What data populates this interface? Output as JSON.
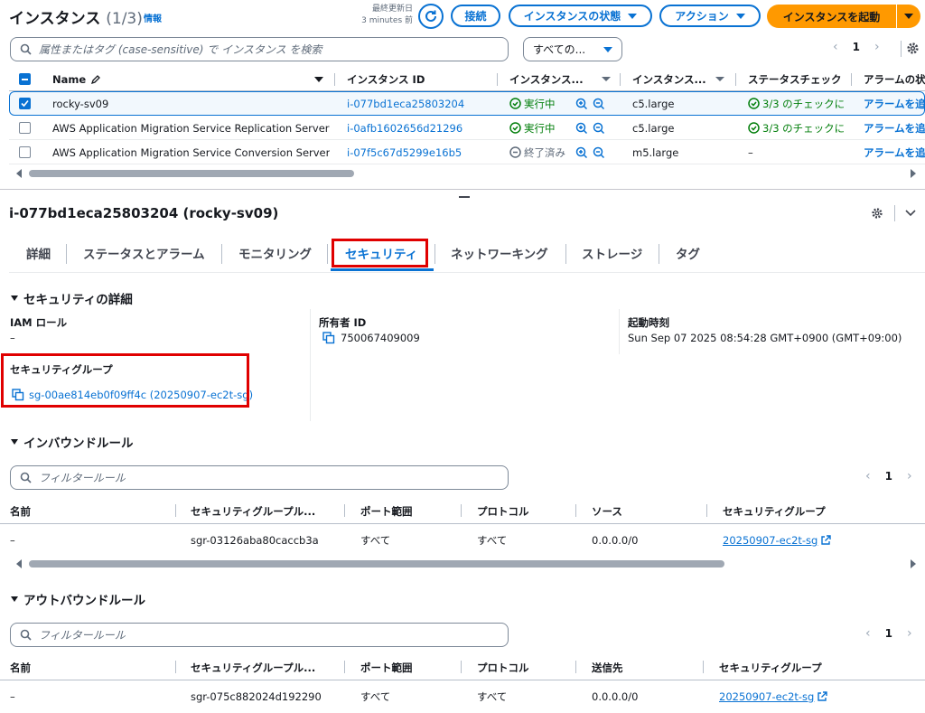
{
  "header": {
    "title": "インスタンス",
    "count": "(1/3)",
    "info": "情報",
    "last_updated_label": "最終更新日",
    "last_updated_value": "3 minutes 前",
    "connect": "接続",
    "instance_state": "インスタンスの状態",
    "actions": "アクション",
    "launch": "インスタンスを起動"
  },
  "search": {
    "placeholder": "属性またはタグ (case-sensitive) で インスタンス を検索",
    "filter": "すべての..."
  },
  "pager": {
    "page": "1"
  },
  "instances": {
    "columns": [
      "Name",
      "インスタンス ID",
      "インスタンス...",
      "インスタンス...",
      "ステータスチェック",
      "アラームの状"
    ],
    "rows": [
      {
        "name": "rocky-sv09",
        "id": "i-077bd1eca25803204",
        "state": "実行中",
        "type": "c5.large",
        "check": "3/3 のチェックに",
        "alarm": "アラームを追"
      },
      {
        "name": "AWS Application Migration Service Replication Server",
        "id": "i-0afb1602656d21296",
        "state": "実行中",
        "type": "c5.large",
        "check": "3/3 のチェックに",
        "alarm": "アラームを追"
      },
      {
        "name": "AWS Application Migration Service Conversion Server",
        "id": "i-07f5c67d5299e16b5",
        "state": "終了済み",
        "type": "m5.large",
        "check": "–",
        "alarm": "アラームを追"
      }
    ]
  },
  "detail": {
    "title": "i-077bd1eca25803204 (rocky-sv09)",
    "tabs": [
      "詳細",
      "ステータスとアラーム",
      "モニタリング",
      "セキュリティ",
      "ネットワーキング",
      "ストレージ",
      "タグ"
    ],
    "security_details": "セキュリティの詳細",
    "iam_label": "IAM ロール",
    "iam_value": "–",
    "owner_label": "所有者 ID",
    "owner_value": "750067409009",
    "launch_label": "起動時刻",
    "launch_value": "Sun Sep 07 2025 08:54:28 GMT+0900 (GMT+09:00)",
    "sg_label": "セキュリティグループ",
    "sg_value": "sg-00ae814eb0f09ff4c (20250907-ec2t-sg)"
  },
  "inbound": {
    "title": "インバウンドルール",
    "placeholder": "フィルタールール",
    "page": "1",
    "columns": [
      "名前",
      "セキュリティグループル...",
      "ポート範囲",
      "プロトコル",
      "ソース",
      "セキュリティグループ"
    ],
    "row": {
      "name": "–",
      "rule_id": "sgr-03126aba80caccb3a",
      "port": "すべて",
      "protocol": "すべて",
      "source": "0.0.0.0/0",
      "sg": "20250907-ec2t-sg"
    }
  },
  "outbound": {
    "title": "アウトバウンドルール",
    "placeholder": "フィルタールール",
    "page": "1",
    "columns": [
      "名前",
      "セキュリティグループル...",
      "ポート範囲",
      "プロトコル",
      "送信先",
      "セキュリティグループ"
    ],
    "row": {
      "name": "–",
      "rule_id": "sgr-075c882024d192290",
      "port": "すべて",
      "protocol": "すべて",
      "dest": "0.0.0.0/0",
      "sg": "20250907-ec2t-sg"
    }
  },
  "colors": {
    "accent": "#0972d3",
    "launch": "#ff9900",
    "success": "#037f0c",
    "highlight": "#e00000"
  }
}
